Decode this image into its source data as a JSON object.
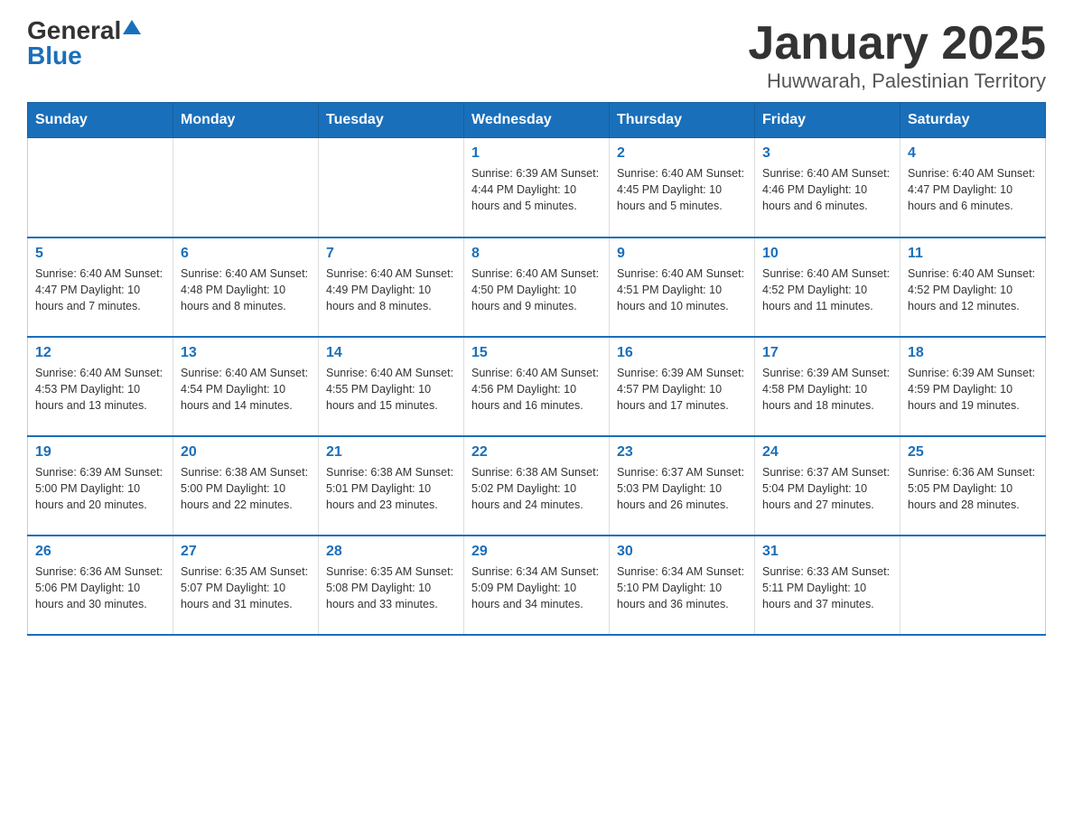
{
  "logo": {
    "general": "General",
    "blue": "Blue"
  },
  "title": "January 2025",
  "subtitle": "Huwwarah, Palestinian Territory",
  "days_of_week": [
    "Sunday",
    "Monday",
    "Tuesday",
    "Wednesday",
    "Thursday",
    "Friday",
    "Saturday"
  ],
  "weeks": [
    [
      {
        "day": "",
        "info": ""
      },
      {
        "day": "",
        "info": ""
      },
      {
        "day": "",
        "info": ""
      },
      {
        "day": "1",
        "info": "Sunrise: 6:39 AM\nSunset: 4:44 PM\nDaylight: 10 hours and 5 minutes."
      },
      {
        "day": "2",
        "info": "Sunrise: 6:40 AM\nSunset: 4:45 PM\nDaylight: 10 hours and 5 minutes."
      },
      {
        "day": "3",
        "info": "Sunrise: 6:40 AM\nSunset: 4:46 PM\nDaylight: 10 hours and 6 minutes."
      },
      {
        "day": "4",
        "info": "Sunrise: 6:40 AM\nSunset: 4:47 PM\nDaylight: 10 hours and 6 minutes."
      }
    ],
    [
      {
        "day": "5",
        "info": "Sunrise: 6:40 AM\nSunset: 4:47 PM\nDaylight: 10 hours and 7 minutes."
      },
      {
        "day": "6",
        "info": "Sunrise: 6:40 AM\nSunset: 4:48 PM\nDaylight: 10 hours and 8 minutes."
      },
      {
        "day": "7",
        "info": "Sunrise: 6:40 AM\nSunset: 4:49 PM\nDaylight: 10 hours and 8 minutes."
      },
      {
        "day": "8",
        "info": "Sunrise: 6:40 AM\nSunset: 4:50 PM\nDaylight: 10 hours and 9 minutes."
      },
      {
        "day": "9",
        "info": "Sunrise: 6:40 AM\nSunset: 4:51 PM\nDaylight: 10 hours and 10 minutes."
      },
      {
        "day": "10",
        "info": "Sunrise: 6:40 AM\nSunset: 4:52 PM\nDaylight: 10 hours and 11 minutes."
      },
      {
        "day": "11",
        "info": "Sunrise: 6:40 AM\nSunset: 4:52 PM\nDaylight: 10 hours and 12 minutes."
      }
    ],
    [
      {
        "day": "12",
        "info": "Sunrise: 6:40 AM\nSunset: 4:53 PM\nDaylight: 10 hours and 13 minutes."
      },
      {
        "day": "13",
        "info": "Sunrise: 6:40 AM\nSunset: 4:54 PM\nDaylight: 10 hours and 14 minutes."
      },
      {
        "day": "14",
        "info": "Sunrise: 6:40 AM\nSunset: 4:55 PM\nDaylight: 10 hours and 15 minutes."
      },
      {
        "day": "15",
        "info": "Sunrise: 6:40 AM\nSunset: 4:56 PM\nDaylight: 10 hours and 16 minutes."
      },
      {
        "day": "16",
        "info": "Sunrise: 6:39 AM\nSunset: 4:57 PM\nDaylight: 10 hours and 17 minutes."
      },
      {
        "day": "17",
        "info": "Sunrise: 6:39 AM\nSunset: 4:58 PM\nDaylight: 10 hours and 18 minutes."
      },
      {
        "day": "18",
        "info": "Sunrise: 6:39 AM\nSunset: 4:59 PM\nDaylight: 10 hours and 19 minutes."
      }
    ],
    [
      {
        "day": "19",
        "info": "Sunrise: 6:39 AM\nSunset: 5:00 PM\nDaylight: 10 hours and 20 minutes."
      },
      {
        "day": "20",
        "info": "Sunrise: 6:38 AM\nSunset: 5:00 PM\nDaylight: 10 hours and 22 minutes."
      },
      {
        "day": "21",
        "info": "Sunrise: 6:38 AM\nSunset: 5:01 PM\nDaylight: 10 hours and 23 minutes."
      },
      {
        "day": "22",
        "info": "Sunrise: 6:38 AM\nSunset: 5:02 PM\nDaylight: 10 hours and 24 minutes."
      },
      {
        "day": "23",
        "info": "Sunrise: 6:37 AM\nSunset: 5:03 PM\nDaylight: 10 hours and 26 minutes."
      },
      {
        "day": "24",
        "info": "Sunrise: 6:37 AM\nSunset: 5:04 PM\nDaylight: 10 hours and 27 minutes."
      },
      {
        "day": "25",
        "info": "Sunrise: 6:36 AM\nSunset: 5:05 PM\nDaylight: 10 hours and 28 minutes."
      }
    ],
    [
      {
        "day": "26",
        "info": "Sunrise: 6:36 AM\nSunset: 5:06 PM\nDaylight: 10 hours and 30 minutes."
      },
      {
        "day": "27",
        "info": "Sunrise: 6:35 AM\nSunset: 5:07 PM\nDaylight: 10 hours and 31 minutes."
      },
      {
        "day": "28",
        "info": "Sunrise: 6:35 AM\nSunset: 5:08 PM\nDaylight: 10 hours and 33 minutes."
      },
      {
        "day": "29",
        "info": "Sunrise: 6:34 AM\nSunset: 5:09 PM\nDaylight: 10 hours and 34 minutes."
      },
      {
        "day": "30",
        "info": "Sunrise: 6:34 AM\nSunset: 5:10 PM\nDaylight: 10 hours and 36 minutes."
      },
      {
        "day": "31",
        "info": "Sunrise: 6:33 AM\nSunset: 5:11 PM\nDaylight: 10 hours and 37 minutes."
      },
      {
        "day": "",
        "info": ""
      }
    ]
  ]
}
